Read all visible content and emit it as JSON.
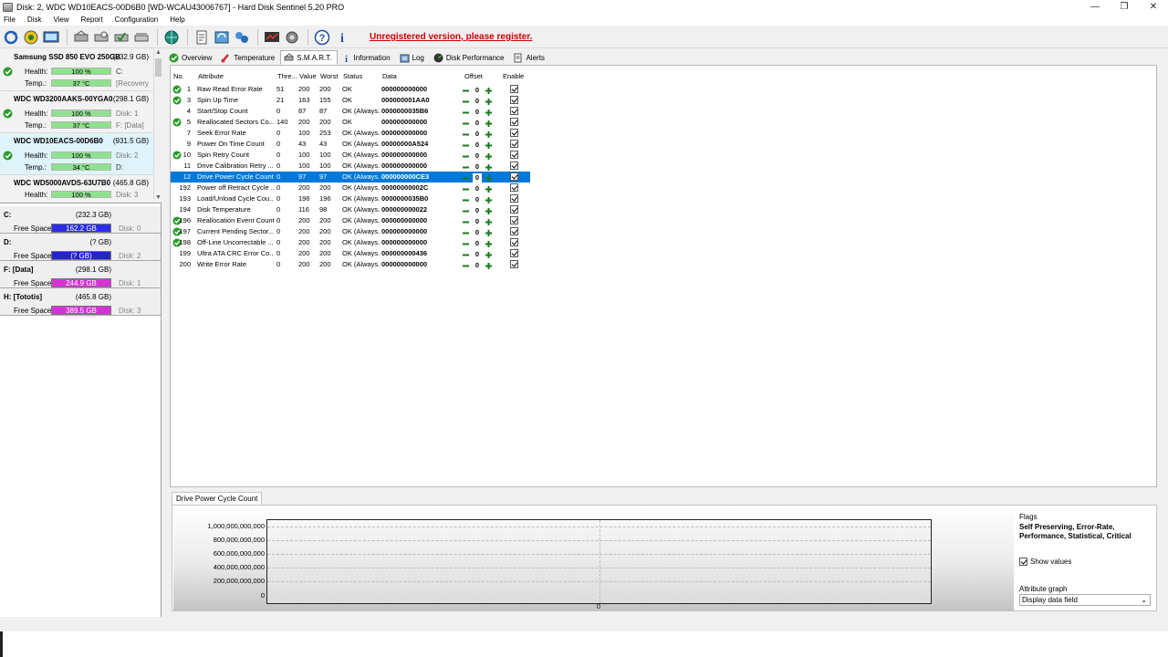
{
  "window": {
    "title": "Disk: 2, WDC WD10EACS-00D6B0 [WD-WCAU43006767]  -  Hard Disk Sentinel 5.20 PRO",
    "minimize": "—",
    "restore": "❐",
    "close": "✕"
  },
  "menu": [
    "File",
    "Disk",
    "View",
    "Report",
    "Configuration",
    "Help"
  ],
  "toolbar": {
    "register_text": "Unregistered version, please register."
  },
  "disks": [
    {
      "name": "Samsung SSD 850 EVO 250GB",
      "size": "(232.9 GB)",
      "health_label": "Health:",
      "health": "100 %",
      "health_aux": "C:",
      "temp_label": "Temp.:",
      "temp": "37 °C",
      "temp_aux": "[Recovery"
    },
    {
      "name": "WDC WD3200AAKS-00YGA0",
      "size": "(298.1 GB)",
      "health_label": "Health:",
      "health": "100 %",
      "health_aux": "Disk: 1",
      "temp_label": "Temp.:",
      "temp": "37 °C",
      "temp_aux": "F: [Data]"
    },
    {
      "name": "WDC WD10EACS-00D6B0",
      "size": "(931.5 GB)",
      "health_label": "Health:",
      "health": "100 %",
      "health_aux": "Disk: 2",
      "temp_label": "Temp.:",
      "temp": "34 °C",
      "temp_aux": "D:"
    },
    {
      "name": "WDC WD5000AVDS-63U7B0",
      "size": "(465.8 GB)",
      "health_label": "Health:",
      "health": "100 %",
      "health_aux": "Disk: 3"
    }
  ],
  "volumes": [
    {
      "name": "C:",
      "size": "(232.3 GB)",
      "free_label": "Free Space",
      "free": "162.2 GB",
      "disk": "Disk: 0",
      "color": "#2d2de6"
    },
    {
      "name": "D:",
      "size": "(? GB)",
      "free_label": "Free Space",
      "free": "(? GB)",
      "disk": "Disk: 2",
      "color": "#2424c8"
    },
    {
      "name": "F: [Data]",
      "size": "(298.1 GB)",
      "free_label": "Free Space",
      "free": "244.9 GB",
      "disk": "Disk: 1",
      "color": "#d633d6"
    },
    {
      "name": "H: [Tototis]",
      "size": "(465.8 GB)",
      "free_label": "Free Space",
      "free": "389.5 GB",
      "disk": "Disk: 3",
      "color": "#d633d6"
    }
  ],
  "tabs": [
    "Overview",
    "Temperature",
    "S.M.A.R.T.",
    "Information",
    "Log",
    "Disk Performance",
    "Alerts"
  ],
  "smart": {
    "headers": {
      "no": "No.",
      "attribute": "Attribute",
      "threshold": "Thre...",
      "value": "Value",
      "worst": "Worst",
      "status": "Status",
      "data": "Data",
      "offset": "Offset",
      "enable": "Enable"
    },
    "rows": [
      {
        "check": true,
        "no": "1",
        "attr": "Raw Read Error Rate",
        "thr": "51",
        "val": "200",
        "worst": "200",
        "status": "OK",
        "data": "000000000000",
        "offset": "0"
      },
      {
        "check": true,
        "no": "3",
        "attr": "Spin Up Time",
        "thr": "21",
        "val": "163",
        "worst": "155",
        "status": "OK",
        "data": "000000001AA0",
        "offset": "0"
      },
      {
        "check": false,
        "no": "4",
        "attr": "Start/Stop Count",
        "thr": "0",
        "val": "87",
        "worst": "87",
        "status": "OK (Always...",
        "data": "0000000035B6",
        "offset": "0"
      },
      {
        "check": true,
        "no": "5",
        "attr": "Reallocated Sectors Co...",
        "thr": "140",
        "val": "200",
        "worst": "200",
        "status": "OK",
        "data": "000000000000",
        "offset": "0"
      },
      {
        "check": false,
        "no": "7",
        "attr": "Seek Error Rate",
        "thr": "0",
        "val": "100",
        "worst": "253",
        "status": "OK (Always...",
        "data": "000000000000",
        "offset": "0"
      },
      {
        "check": false,
        "no": "9",
        "attr": "Power On Time Count",
        "thr": "0",
        "val": "43",
        "worst": "43",
        "status": "OK (Always...",
        "data": "00000000A524",
        "offset": "0"
      },
      {
        "check": true,
        "no": "10",
        "attr": "Spin Retry Count",
        "thr": "0",
        "val": "100",
        "worst": "100",
        "status": "OK (Always...",
        "data": "000000000000",
        "offset": "0"
      },
      {
        "check": false,
        "no": "11",
        "attr": "Drive Calibration Retry ...",
        "thr": "0",
        "val": "100",
        "worst": "100",
        "status": "OK (Always...",
        "data": "000000000000",
        "offset": "0"
      },
      {
        "check": false,
        "no": "12",
        "attr": "Drive Power Cycle Count",
        "thr": "0",
        "val": "97",
        "worst": "97",
        "status": "OK (Always...",
        "data": "000000000CE3",
        "offset": "0",
        "selected": true
      },
      {
        "check": false,
        "no": "192",
        "attr": "Power off Retract Cycle ...",
        "thr": "0",
        "val": "200",
        "worst": "200",
        "status": "OK (Always...",
        "data": "00000000002C",
        "offset": "0"
      },
      {
        "check": false,
        "no": "193",
        "attr": "Load/Unload Cycle Cou...",
        "thr": "0",
        "val": "196",
        "worst": "196",
        "status": "OK (Always...",
        "data": "0000000035B0",
        "offset": "0"
      },
      {
        "check": false,
        "no": "194",
        "attr": "Disk Temperature",
        "thr": "0",
        "val": "116",
        "worst": "98",
        "status": "OK (Always...",
        "data": "000000000022",
        "offset": "0"
      },
      {
        "check": true,
        "no": "196",
        "attr": "Reallocation Event Count",
        "thr": "0",
        "val": "200",
        "worst": "200",
        "status": "OK (Always...",
        "data": "000000000000",
        "offset": "0"
      },
      {
        "check": true,
        "no": "197",
        "attr": "Current Pending Sector...",
        "thr": "0",
        "val": "200",
        "worst": "200",
        "status": "OK (Always...",
        "data": "000000000000",
        "offset": "0"
      },
      {
        "check": true,
        "no": "198",
        "attr": "Off-Line Uncorrectable ...",
        "thr": "0",
        "val": "200",
        "worst": "200",
        "status": "OK (Always...",
        "data": "000000000000",
        "offset": "0"
      },
      {
        "check": false,
        "no": "199",
        "attr": "Ultra ATA CRC Error Co...",
        "thr": "0",
        "val": "200",
        "worst": "200",
        "status": "OK (Always...",
        "data": "000000000436",
        "offset": "0"
      },
      {
        "check": false,
        "no": "200",
        "attr": "Write Error Rate",
        "thr": "0",
        "val": "200",
        "worst": "200",
        "status": "OK (Always...",
        "data": "000000000000",
        "offset": "0"
      }
    ]
  },
  "graph": {
    "tab_label": "Drive Power Cycle Count",
    "yticks": [
      "1,000,000,000,000",
      "800,000,000,000",
      "600,000,000,000",
      "400,000,000,000",
      "200,000,000,000",
      "0"
    ],
    "x_label": "0",
    "flags_title": "Flags",
    "flags_value": "Self Preserving, Error-Rate, Performance, Statistical, Critical",
    "show_values": "Show values",
    "attr_graph_label": "Attribute graph",
    "attr_graph_value": "Display data field"
  }
}
